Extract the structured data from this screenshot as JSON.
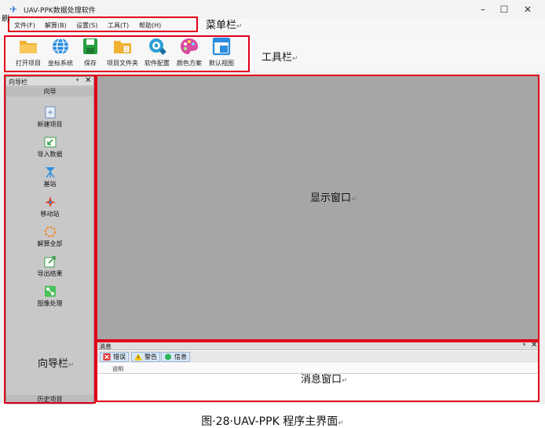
{
  "window": {
    "title": "UAV-PPK数据处理软件",
    "controls": [
      "min",
      "max",
      "close"
    ]
  },
  "menu": [
    {
      "label": "文件(F)"
    },
    {
      "label": "解算(B)"
    },
    {
      "label": "设置(S)"
    },
    {
      "label": "工具(T)"
    },
    {
      "label": "帮助(H)"
    }
  ],
  "toolbar": [
    {
      "label": "打开项目",
      "icon": "folder-open-icon",
      "color": "#f2b233"
    },
    {
      "label": "坐标系统",
      "icon": "globe-icon",
      "color": "#2b8de0"
    },
    {
      "label": "保存",
      "icon": "save-icon",
      "color": "#27a040"
    },
    {
      "label": "项目文件夹",
      "icon": "project-folder-icon",
      "color": "#f2b233"
    },
    {
      "label": "软件配置",
      "icon": "config-icon",
      "color": "#2ca0d4"
    },
    {
      "label": "颜色方案",
      "icon": "palette-icon",
      "color": "#d84aa0"
    },
    {
      "label": "默认视图",
      "icon": "default-view-icon",
      "color": "#2b8de0"
    }
  ],
  "nav": {
    "title": "向导栏",
    "subtitle": "向导",
    "items": [
      {
        "label": "新建项目",
        "icon": "new-project-icon"
      },
      {
        "label": "导入数据",
        "icon": "import-data-icon"
      },
      {
        "label": "基站",
        "icon": "base-station-icon"
      },
      {
        "label": "移动站",
        "icon": "rover-icon"
      },
      {
        "label": "解算全部",
        "icon": "solve-all-icon"
      },
      {
        "label": "导出结果",
        "icon": "export-result-icon"
      },
      {
        "label": "图像处理",
        "icon": "image-process-icon"
      }
    ],
    "history": "历史项目"
  },
  "message": {
    "title": "消息",
    "tabs": [
      {
        "label": "错误",
        "icon": "error-icon",
        "color": "#e03030"
      },
      {
        "label": "警告",
        "icon": "warning-icon",
        "color": "#f2c200"
      },
      {
        "label": "信息",
        "icon": "info-icon",
        "color": "#2db55d"
      }
    ],
    "column": "说明"
  },
  "annotations": {
    "menubar": "菜单栏",
    "toolbar": "工具栏",
    "display": "显示窗口",
    "nav": "向导栏",
    "message": "消息窗口",
    "return_mark": "↵",
    "tl_fragment": "刷"
  },
  "caption": "图·28·UAV-PPK 程序主界面",
  "colors": {
    "highlight": "#e3001b",
    "display_bg": "#a6a6a6",
    "panel_bg": "#c8c8c8"
  }
}
